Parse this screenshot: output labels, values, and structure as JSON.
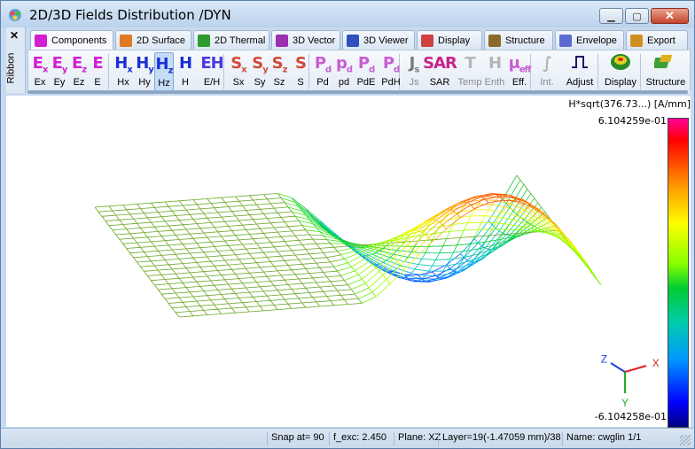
{
  "window": {
    "title": "2D/3D Fields Distribution /DYN",
    "min_icon": "minimize-icon",
    "max_icon": "maximize-icon",
    "close_icon": "close-icon"
  },
  "ribbon": {
    "side_label": "Ribbon",
    "close_symbol": "✕"
  },
  "tabs": [
    {
      "label": "Components",
      "active": true
    },
    {
      "label": "2D Surface"
    },
    {
      "label": "2D Thermal"
    },
    {
      "label": "3D Vector"
    },
    {
      "label": "3D Viewer"
    },
    {
      "label": "Display"
    },
    {
      "label": "Structure"
    },
    {
      "label": "Envelope"
    },
    {
      "label": "Export"
    }
  ],
  "toolbar": {
    "items": [
      {
        "glyph": "E",
        "sub": "x",
        "label": "Ex"
      },
      {
        "glyph": "E",
        "sub": "y",
        "label": "Ey"
      },
      {
        "glyph": "E",
        "sub": "z",
        "label": "Ez"
      },
      {
        "glyph": "E",
        "sub": "",
        "label": "E"
      },
      {
        "glyph": "H",
        "sub": "x",
        "label": "Hx"
      },
      {
        "glyph": "H",
        "sub": "y",
        "label": "Hy"
      },
      {
        "glyph": "H",
        "sub": "z",
        "label": "Hz"
      },
      {
        "glyph": "H",
        "sub": "",
        "label": "H"
      },
      {
        "glyph": "EH",
        "sub": "",
        "label": "E/H"
      },
      {
        "glyph": "S",
        "sub": "x",
        "label": "Sx"
      },
      {
        "glyph": "S",
        "sub": "y",
        "label": "Sy"
      },
      {
        "glyph": "S",
        "sub": "z",
        "label": "Sz"
      },
      {
        "glyph": "S",
        "sub": "",
        "label": "S"
      },
      {
        "glyph": "P",
        "sub": "d",
        "label": "Pd"
      },
      {
        "glyph": "p",
        "sub": "d",
        "label": "pd"
      },
      {
        "glyph": "P",
        "sub": "d",
        "label": "PdE"
      },
      {
        "glyph": "P",
        "sub": "d",
        "label": "PdH"
      },
      {
        "glyph": "J",
        "sub": "s",
        "label": "Js"
      },
      {
        "glyph": "SAR",
        "sub": "",
        "label": "SAR"
      },
      {
        "glyph": "T",
        "sub": "",
        "label": "Temp"
      },
      {
        "glyph": "H",
        "sub": "",
        "label": "Enth"
      },
      {
        "glyph": "μ",
        "sub": "eff",
        "label": "Eff."
      },
      {
        "glyph": "∫",
        "sub": "",
        "label": "Int."
      },
      {
        "glyph": "⊓",
        "sub": "",
        "label": "Adjust"
      },
      {
        "glyph": "",
        "sub": "",
        "label": "Display"
      },
      {
        "glyph": "",
        "sub": "",
        "label": "Structure"
      }
    ],
    "selected": "Hz"
  },
  "plot": {
    "colorbar_title": "H*sqrt(376.73...) [A/mm]",
    "colorbar_max": "6.104259e-01",
    "colorbar_min": "-6.104258e-01",
    "axis_labels": {
      "x": "X",
      "y": "Y",
      "z": "Z"
    },
    "colors": {
      "mesh": "#6aa826",
      "bg": "#ffffff"
    }
  },
  "status": {
    "snap": "Snap at=  90",
    "f_exc": "f_exc:  2.450",
    "plane": "Plane: XZ",
    "layer": "Layer=19(-1.47059 mm)/38",
    "name": "Name: cwglin 1/1"
  }
}
